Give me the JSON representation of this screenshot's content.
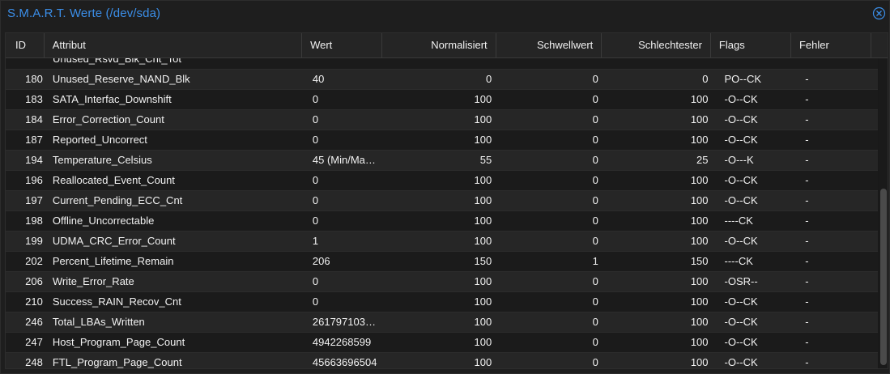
{
  "window": {
    "title": "S.M.A.R.T. Werte (/dev/sda)",
    "close_icon": "close-circle-icon",
    "accent_color": "#3b8ee8"
  },
  "table": {
    "columns": [
      "ID",
      "Attribut",
      "Wert",
      "Normalisiert",
      "Schwellwert",
      "Schlechtester",
      "Flags",
      "Fehler"
    ],
    "partial_row": {
      "attribute": "Unused_Rsvd_Blk_Cnt_Tot"
    },
    "rows": [
      {
        "id": "180",
        "attribute": "Unused_Reserve_NAND_Blk",
        "value": "40",
        "normalized": "0",
        "threshold": "0",
        "worst": "0",
        "flags": "PO--CK",
        "errors": "-"
      },
      {
        "id": "183",
        "attribute": "SATA_Interfac_Downshift",
        "value": "0",
        "normalized": "100",
        "threshold": "0",
        "worst": "100",
        "flags": "-O--CK",
        "errors": "-"
      },
      {
        "id": "184",
        "attribute": "Error_Correction_Count",
        "value": "0",
        "normalized": "100",
        "threshold": "0",
        "worst": "100",
        "flags": "-O--CK",
        "errors": "-"
      },
      {
        "id": "187",
        "attribute": "Reported_Uncorrect",
        "value": "0",
        "normalized": "100",
        "threshold": "0",
        "worst": "100",
        "flags": "-O--CK",
        "errors": "-"
      },
      {
        "id": "194",
        "attribute": "Temperature_Celsius",
        "value": "45 (Min/Ma…",
        "normalized": "55",
        "threshold": "0",
        "worst": "25",
        "flags": "-O---K",
        "errors": "-"
      },
      {
        "id": "196",
        "attribute": "Reallocated_Event_Count",
        "value": "0",
        "normalized": "100",
        "threshold": "0",
        "worst": "100",
        "flags": "-O--CK",
        "errors": "-"
      },
      {
        "id": "197",
        "attribute": "Current_Pending_ECC_Cnt",
        "value": "0",
        "normalized": "100",
        "threshold": "0",
        "worst": "100",
        "flags": "-O--CK",
        "errors": "-"
      },
      {
        "id": "198",
        "attribute": "Offline_Uncorrectable",
        "value": "0",
        "normalized": "100",
        "threshold": "0",
        "worst": "100",
        "flags": "----CK",
        "errors": "-"
      },
      {
        "id": "199",
        "attribute": "UDMA_CRC_Error_Count",
        "value": "1",
        "normalized": "100",
        "threshold": "0",
        "worst": "100",
        "flags": "-O--CK",
        "errors": "-"
      },
      {
        "id": "202",
        "attribute": "Percent_Lifetime_Remain",
        "value": "206",
        "normalized": "150",
        "threshold": "1",
        "worst": "150",
        "flags": "----CK",
        "errors": "-"
      },
      {
        "id": "206",
        "attribute": "Write_Error_Rate",
        "value": "0",
        "normalized": "100",
        "threshold": "0",
        "worst": "100",
        "flags": "-OSR--",
        "errors": "-"
      },
      {
        "id": "210",
        "attribute": "Success_RAIN_Recov_Cnt",
        "value": "0",
        "normalized": "100",
        "threshold": "0",
        "worst": "100",
        "flags": "-O--CK",
        "errors": "-"
      },
      {
        "id": "246",
        "attribute": "Total_LBAs_Written",
        "value": "261797103…",
        "normalized": "100",
        "threshold": "0",
        "worst": "100",
        "flags": "-O--CK",
        "errors": "-"
      },
      {
        "id": "247",
        "attribute": "Host_Program_Page_Count",
        "value": "4942268599",
        "normalized": "100",
        "threshold": "0",
        "worst": "100",
        "flags": "-O--CK",
        "errors": "-"
      },
      {
        "id": "248",
        "attribute": "FTL_Program_Page_Count",
        "value": "45663696504",
        "normalized": "100",
        "threshold": "0",
        "worst": "100",
        "flags": "-O--CK",
        "errors": "-"
      }
    ],
    "scroll_position": 1.0
  }
}
